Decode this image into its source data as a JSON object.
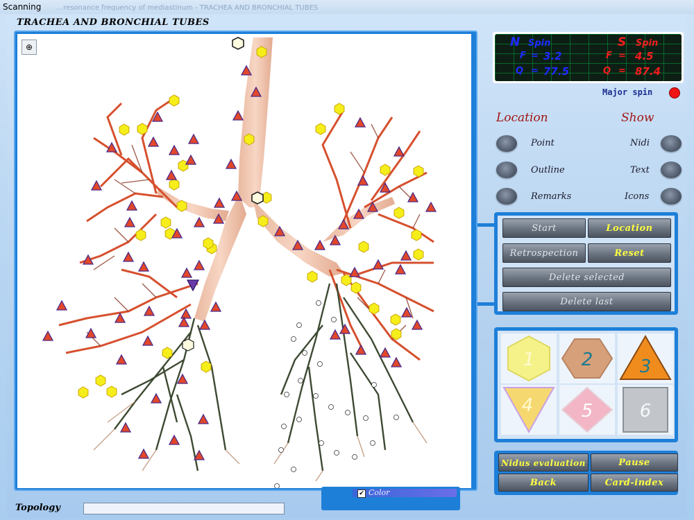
{
  "window": {
    "title": "Scanning",
    "faded_caption": "…resonance frequency of mediastinum - TRACHEA AND BRONCHIAL TUBES"
  },
  "image_view": {
    "heading": "TRACHEA AND BRONCHIAL TUBES",
    "zoom_icon": "zoom-in-icon"
  },
  "spin_display": {
    "n": {
      "label": "N",
      "word": "Spin",
      "f_label": "F",
      "f_value": "3.2",
      "q_label": "Q",
      "q_value": "77.5"
    },
    "s": {
      "label": "S",
      "word": "Spin",
      "f_label": "F",
      "f_value": "4.5",
      "q_label": "Q",
      "q_value": "87.4"
    },
    "major_spin_label": "Major spin",
    "major_spin_color": "#f01616"
  },
  "location": {
    "title": "Location",
    "options": [
      "Point",
      "Outline",
      "Remarks"
    ]
  },
  "show": {
    "title": "Show",
    "options": [
      "Nidi",
      "Text",
      "Icons"
    ]
  },
  "controls": {
    "start": "Start",
    "location": "Location",
    "retrospection": "Retrospection",
    "reset": "Reset",
    "delete_selected": "Delete selected",
    "delete_last": "Delete last"
  },
  "markers": [
    {
      "number": "1",
      "shape": "hexagon",
      "color": "#f3f07a"
    },
    {
      "number": "2",
      "shape": "hexagon",
      "color": "#d9a77a"
    },
    {
      "number": "3",
      "shape": "triangle-up",
      "color": "#f08a1c"
    },
    {
      "number": "4",
      "shape": "triangle-down",
      "color": "#f6d870"
    },
    {
      "number": "5",
      "shape": "diamond",
      "color": "#f2b6c6"
    },
    {
      "number": "6",
      "shape": "square",
      "color": "#c2c6ca"
    }
  ],
  "bottom_buttons": {
    "nidus_evaluation": "Nidus evaluation",
    "pause": "Pause",
    "back": "Back",
    "card_index": "Card-index"
  },
  "footer": {
    "topology_label": "Topology",
    "color_checkbox_label": "Color",
    "color_checked": true
  }
}
